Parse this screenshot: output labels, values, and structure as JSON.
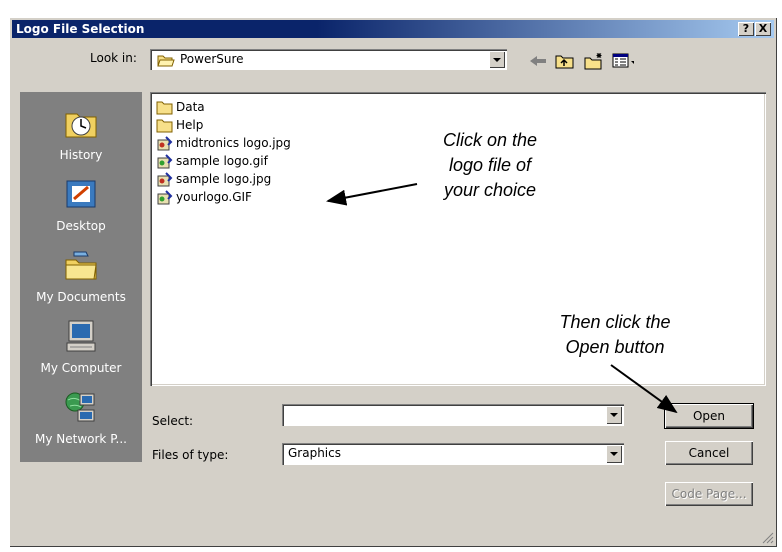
{
  "window": {
    "title": "Logo File Selection",
    "help_glyph": "?",
    "close_glyph": "X"
  },
  "look_in": {
    "label": "Look in:",
    "value": "PowerSure"
  },
  "places": [
    {
      "label": "History",
      "icon": "history-icon"
    },
    {
      "label": "Desktop",
      "icon": "desktop-icon"
    },
    {
      "label": "My Documents",
      "icon": "my-documents-icon"
    },
    {
      "label": "My Computer",
      "icon": "my-computer-icon"
    },
    {
      "label": "My Network P...",
      "icon": "my-network-places-icon"
    }
  ],
  "files": [
    {
      "name": "Data",
      "type": "folder"
    },
    {
      "name": "Help",
      "type": "folder"
    },
    {
      "name": "midtronics logo.jpg",
      "type": "image"
    },
    {
      "name": "sample logo.gif",
      "type": "image"
    },
    {
      "name": "sample logo.jpg",
      "type": "image"
    },
    {
      "name": "yourlogo.GIF",
      "type": "image"
    }
  ],
  "select": {
    "label": "Select:",
    "value": ""
  },
  "files_of_type": {
    "label": "Files of type:",
    "value": "Graphics"
  },
  "buttons": {
    "open": "Open",
    "cancel": "Cancel",
    "code_page": "Code Page..."
  },
  "annotations": {
    "first": [
      "Click on the",
      "logo file of",
      "your choice"
    ],
    "second": [
      "Then click the",
      "Open button"
    ]
  }
}
